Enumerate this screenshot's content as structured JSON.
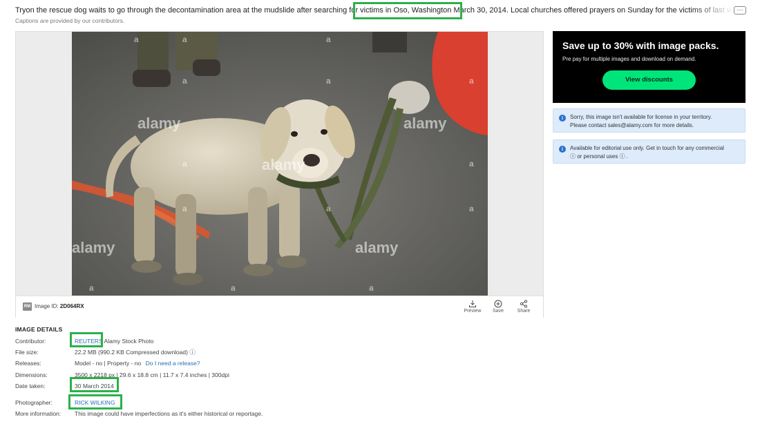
{
  "caption": {
    "text": "Tryon the rescue dog waits to go through the decontamination area at the mudslide after searching for victims in Oso, Washington March 30, 2014. Local churches offered prayers on Sunday for the victims of last week's devastating mudslide",
    "more_label": "···",
    "note": "Captions are provided by our contributors."
  },
  "viewer": {
    "watermark": "alamy",
    "watermark_small": "a",
    "badge": "RM",
    "image_id_label": "Image ID:",
    "image_id": "2D064RX",
    "actions": [
      {
        "label": "Preview",
        "icon": "download-icon"
      },
      {
        "label": "Save",
        "icon": "plus-circle-icon"
      },
      {
        "label": "Share",
        "icon": "share-icon"
      }
    ]
  },
  "promo": {
    "title": "Save up to 30% with image packs.",
    "subtitle": "Pre pay for multiple images and download on demand.",
    "button": "View discounts"
  },
  "notices": [
    {
      "icon": "i",
      "line1": "Sorry, this image isn't available for license in your territory.",
      "line2": "Please contact sales@alamy.com for more details."
    },
    {
      "icon": "i",
      "line1": "Available for editorial use only. Get in touch for any commercial",
      "line2": "ⓘ or personal uses ⓘ ."
    }
  ],
  "details": {
    "title": "IMAGE DETAILS",
    "contributor_label": "Contributor:",
    "contributor_link": "REUTERS",
    "contributor_rest": "Alamy Stock Photo",
    "filesize_label": "File size:",
    "filesize_value": "22.2 MB (990.2 KB Compressed download)",
    "filesize_icon": "ⓘ",
    "releases_label": "Releases:",
    "releases_value": "Model - no | Property - no",
    "releases_link": "Do I need a release?",
    "dimensions_label": "Dimensions:",
    "dimensions_value": "3500 x 2218 px | 29.6 x 18.8 cm | 11.7 x 7.4 inches | 300dpi",
    "date_label": "Date taken:",
    "date_value": "30 March 2014",
    "photographer_label": "Photographer:",
    "photographer_value": "RICK WILKING",
    "more_label": "More information:",
    "more_value": "This image could have imperfections as it's either historical or reportage."
  },
  "colors": {
    "highlight": "#2bb04a",
    "promo_button": "#00e57a",
    "link": "#2a6fb5",
    "notice_bg": "#deebfa"
  }
}
